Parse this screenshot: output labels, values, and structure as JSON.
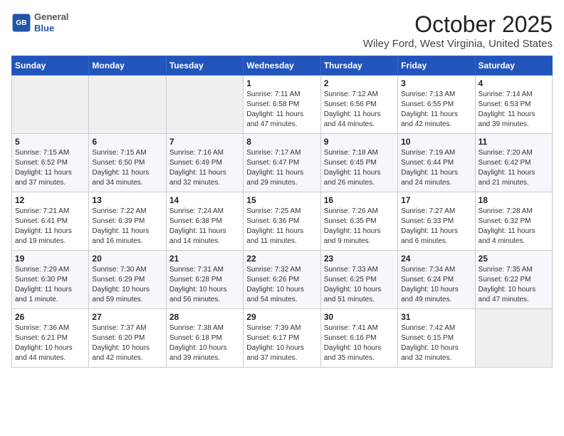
{
  "header": {
    "logo_line1": "General",
    "logo_line2": "Blue",
    "month": "October 2025",
    "location": "Wiley Ford, West Virginia, United States"
  },
  "weekdays": [
    "Sunday",
    "Monday",
    "Tuesday",
    "Wednesday",
    "Thursday",
    "Friday",
    "Saturday"
  ],
  "weeks": [
    [
      {
        "day": "",
        "info": ""
      },
      {
        "day": "",
        "info": ""
      },
      {
        "day": "",
        "info": ""
      },
      {
        "day": "1",
        "info": "Sunrise: 7:11 AM\nSunset: 6:58 PM\nDaylight: 11 hours\nand 47 minutes."
      },
      {
        "day": "2",
        "info": "Sunrise: 7:12 AM\nSunset: 6:56 PM\nDaylight: 11 hours\nand 44 minutes."
      },
      {
        "day": "3",
        "info": "Sunrise: 7:13 AM\nSunset: 6:55 PM\nDaylight: 11 hours\nand 42 minutes."
      },
      {
        "day": "4",
        "info": "Sunrise: 7:14 AM\nSunset: 6:53 PM\nDaylight: 11 hours\nand 39 minutes."
      }
    ],
    [
      {
        "day": "5",
        "info": "Sunrise: 7:15 AM\nSunset: 6:52 PM\nDaylight: 11 hours\nand 37 minutes."
      },
      {
        "day": "6",
        "info": "Sunrise: 7:15 AM\nSunset: 6:50 PM\nDaylight: 11 hours\nand 34 minutes."
      },
      {
        "day": "7",
        "info": "Sunrise: 7:16 AM\nSunset: 6:49 PM\nDaylight: 11 hours\nand 32 minutes."
      },
      {
        "day": "8",
        "info": "Sunrise: 7:17 AM\nSunset: 6:47 PM\nDaylight: 11 hours\nand 29 minutes."
      },
      {
        "day": "9",
        "info": "Sunrise: 7:18 AM\nSunset: 6:45 PM\nDaylight: 11 hours\nand 26 minutes."
      },
      {
        "day": "10",
        "info": "Sunrise: 7:19 AM\nSunset: 6:44 PM\nDaylight: 11 hours\nand 24 minutes."
      },
      {
        "day": "11",
        "info": "Sunrise: 7:20 AM\nSunset: 6:42 PM\nDaylight: 11 hours\nand 21 minutes."
      }
    ],
    [
      {
        "day": "12",
        "info": "Sunrise: 7:21 AM\nSunset: 6:41 PM\nDaylight: 11 hours\nand 19 minutes."
      },
      {
        "day": "13",
        "info": "Sunrise: 7:22 AM\nSunset: 6:39 PM\nDaylight: 11 hours\nand 16 minutes."
      },
      {
        "day": "14",
        "info": "Sunrise: 7:24 AM\nSunset: 6:38 PM\nDaylight: 11 hours\nand 14 minutes."
      },
      {
        "day": "15",
        "info": "Sunrise: 7:25 AM\nSunset: 6:36 PM\nDaylight: 11 hours\nand 11 minutes."
      },
      {
        "day": "16",
        "info": "Sunrise: 7:26 AM\nSunset: 6:35 PM\nDaylight: 11 hours\nand 9 minutes."
      },
      {
        "day": "17",
        "info": "Sunrise: 7:27 AM\nSunset: 6:33 PM\nDaylight: 11 hours\nand 6 minutes."
      },
      {
        "day": "18",
        "info": "Sunrise: 7:28 AM\nSunset: 6:32 PM\nDaylight: 11 hours\nand 4 minutes."
      }
    ],
    [
      {
        "day": "19",
        "info": "Sunrise: 7:29 AM\nSunset: 6:30 PM\nDaylight: 11 hours\nand 1 minute."
      },
      {
        "day": "20",
        "info": "Sunrise: 7:30 AM\nSunset: 6:29 PM\nDaylight: 10 hours\nand 59 minutes."
      },
      {
        "day": "21",
        "info": "Sunrise: 7:31 AM\nSunset: 6:28 PM\nDaylight: 10 hours\nand 56 minutes."
      },
      {
        "day": "22",
        "info": "Sunrise: 7:32 AM\nSunset: 6:26 PM\nDaylight: 10 hours\nand 54 minutes."
      },
      {
        "day": "23",
        "info": "Sunrise: 7:33 AM\nSunset: 6:25 PM\nDaylight: 10 hours\nand 51 minutes."
      },
      {
        "day": "24",
        "info": "Sunrise: 7:34 AM\nSunset: 6:24 PM\nDaylight: 10 hours\nand 49 minutes."
      },
      {
        "day": "25",
        "info": "Sunrise: 7:35 AM\nSunset: 6:22 PM\nDaylight: 10 hours\nand 47 minutes."
      }
    ],
    [
      {
        "day": "26",
        "info": "Sunrise: 7:36 AM\nSunset: 6:21 PM\nDaylight: 10 hours\nand 44 minutes."
      },
      {
        "day": "27",
        "info": "Sunrise: 7:37 AM\nSunset: 6:20 PM\nDaylight: 10 hours\nand 42 minutes."
      },
      {
        "day": "28",
        "info": "Sunrise: 7:38 AM\nSunset: 6:18 PM\nDaylight: 10 hours\nand 39 minutes."
      },
      {
        "day": "29",
        "info": "Sunrise: 7:39 AM\nSunset: 6:17 PM\nDaylight: 10 hours\nand 37 minutes."
      },
      {
        "day": "30",
        "info": "Sunrise: 7:41 AM\nSunset: 6:16 PM\nDaylight: 10 hours\nand 35 minutes."
      },
      {
        "day": "31",
        "info": "Sunrise: 7:42 AM\nSunset: 6:15 PM\nDaylight: 10 hours\nand 32 minutes."
      },
      {
        "day": "",
        "info": ""
      }
    ]
  ]
}
